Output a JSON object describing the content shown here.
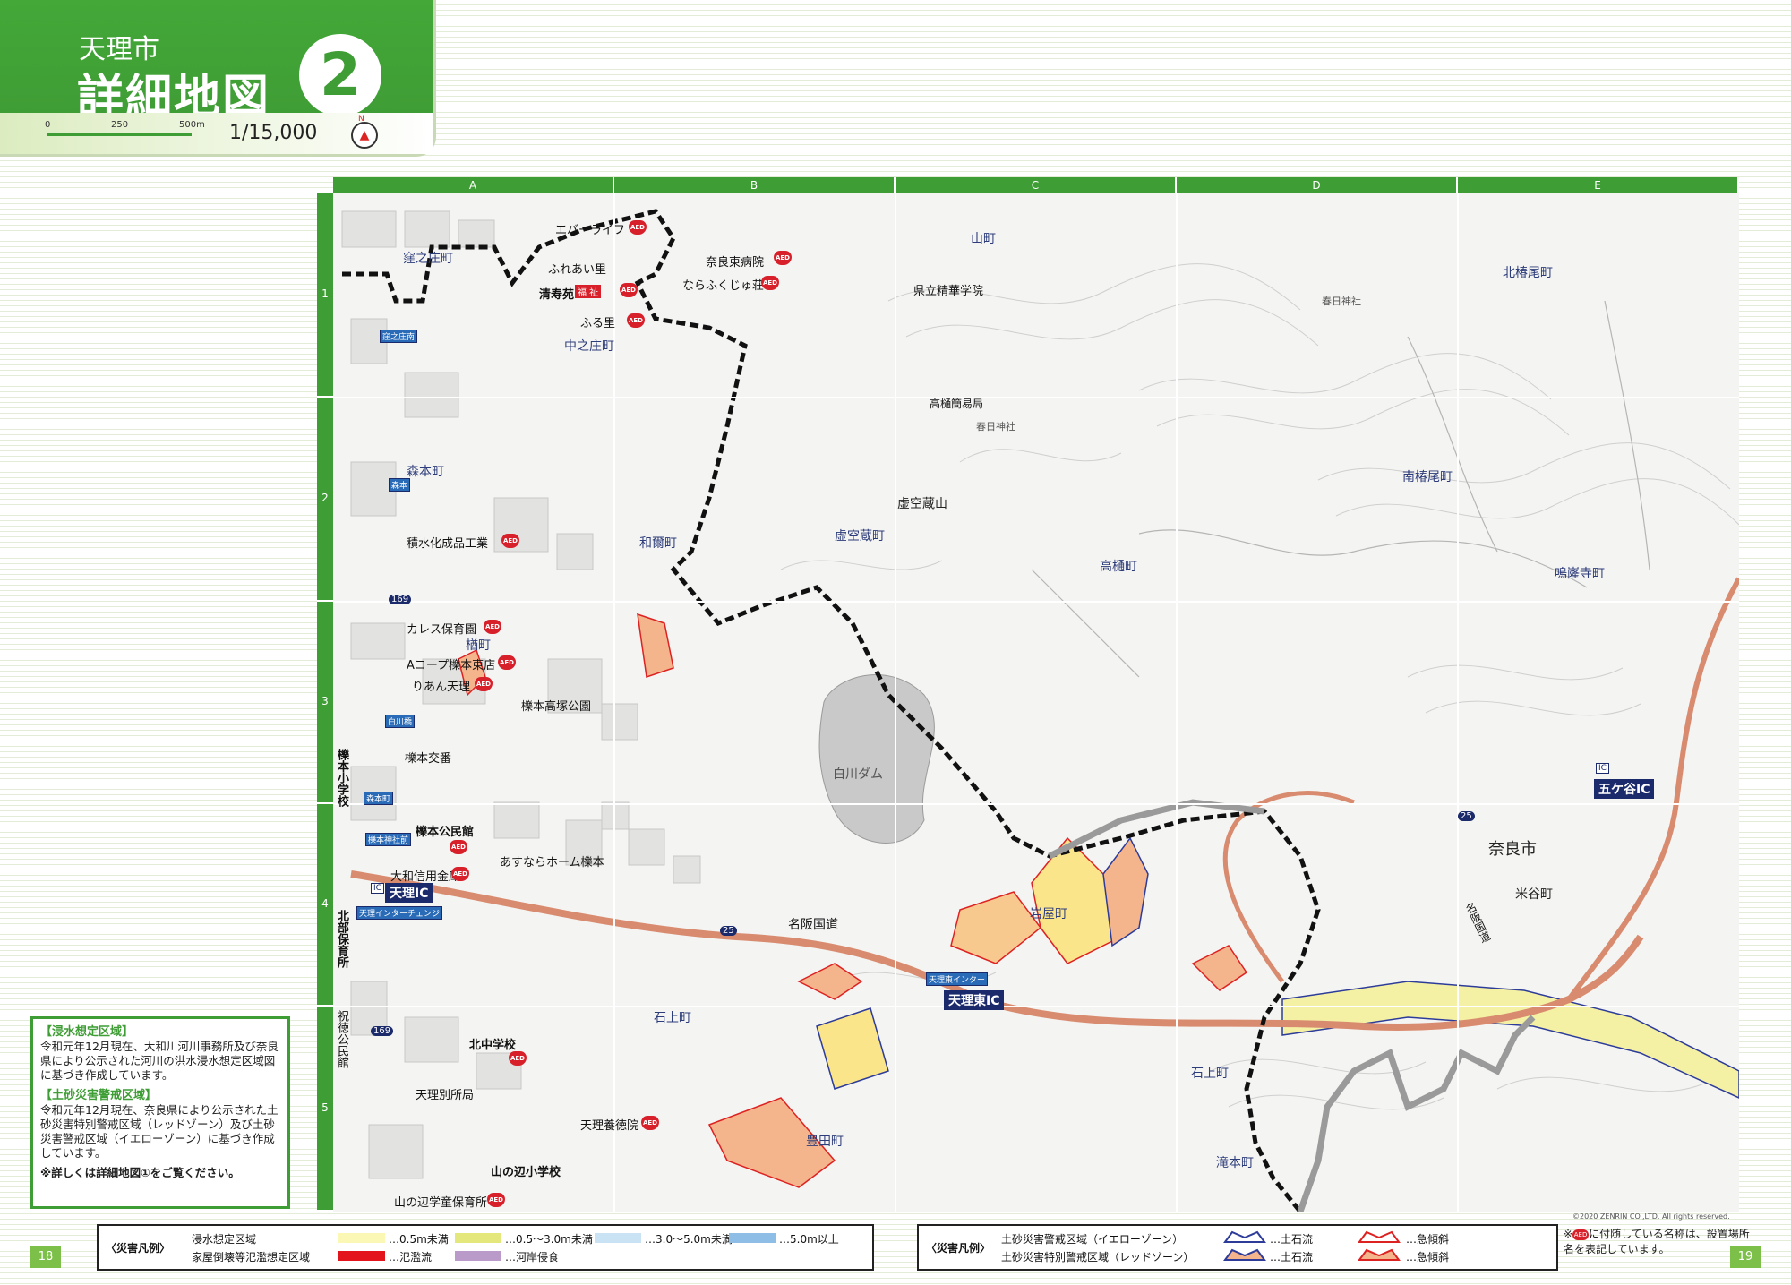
{
  "header": {
    "city": "天理市",
    "title": "詳細地図",
    "map_number": "2",
    "scale_ticks": [
      "0",
      "250",
      "500m"
    ],
    "scale_ratio": "1/15,000",
    "north": "N"
  },
  "grid": {
    "columns": [
      "A",
      "B",
      "C",
      "D",
      "E"
    ],
    "rows": [
      "1",
      "2",
      "3",
      "4",
      "5"
    ]
  },
  "map": {
    "area_labels": {
      "kuboshocho": "窪之庄町",
      "nakanoshocho": "中之庄町",
      "yamacho": "山町",
      "kitatsubaocho": "北椿尾町",
      "moricho": "森本町",
      "wanicho": "和爾町",
      "kokuzocho": "虚空蔵町",
      "takahicho": "高樋町",
      "minamitsubaocho": "南椿尾町",
      "ryuzanjicho": "鳴嶐寺町",
      "naracity": "奈良市",
      "yonetanicho": "米谷町",
      "iwayacho": "岩屋町",
      "isonokamicho": "石上町",
      "isonokamicho2": "石上町",
      "takimotocho": "滝本町",
      "toyodacho": "豊田町",
      "shirakawa_dam": "白川ダム",
      "kokuzozan": "虚空蔵山",
      "nashima": "楢町",
      "kasuga": "春日神社",
      "kasuga2": "春日神社"
    },
    "facilities": {
      "ever_life": "エバーライフ",
      "fureai": "ふれあい里",
      "nara_east_hosp": "奈良東病院",
      "narafukujusou": "ならふくじゅ荘",
      "seijuen": "清寿苑",
      "fukushi": "福 祉",
      "furusato": "ふる里",
      "prefectural": "県立精華学院",
      "takahi_post": "高樋簡易局",
      "kakou": "積水化成品工業",
      "karesu": "カレス保育園",
      "acoop": "Aコープ櫟本東店",
      "rian": "りあん天理",
      "park": "櫟本高塚公園",
      "koban": "櫟本交番",
      "elem": "櫟本小学校",
      "kominkan": "櫟本公民館",
      "asunara": "あすならホーム櫟本",
      "daiwa": "大和信用金庫",
      "hokubu_hoiku": "北部保育所",
      "kita_jhs": "北中学校",
      "bessho": "天理別所局",
      "yoseikan": "天理養徳院",
      "yamanobe_elem": "山の辺小学校",
      "yamanobe_hoiku": "山の辺学童保育所",
      "shukutoku": "祝徳公民館"
    },
    "roads": {
      "meihan": "名阪国道",
      "route25": "25",
      "route25b": "25",
      "route169": "169",
      "route169b": "169",
      "meihan_vertical": "名阪国道"
    },
    "interchanges": {
      "tenri_ic": "天理IC",
      "tenri_east_ic": "天理東IC",
      "gokatani_ic": "五ケ谷IC",
      "tenri_inter": "天理インターチェンジ",
      "tenri_east_inter": "天理東インター",
      "ic_tag": "IC",
      "ic_tag2": "IC"
    },
    "bus_stops": {
      "kubo": "窪之庄南",
      "mori": "森本",
      "shirakawa": "白川橋",
      "moricho_bus": "森本町",
      "ichinomoto": "櫟本神社前"
    },
    "aed": "AED",
    "copyright": "©2020 ZENRIN CO.,LTD. All rights reserved."
  },
  "info": {
    "flood_title": "【浸水想定区域】",
    "flood_text": "令和元年12月現在、大和川河川事務所及び奈良県により公示された河川の洪水浸水想定区域図に基づき作成しています。",
    "sediment_title": "【土砂災害警戒区域】",
    "sediment_text": "令和元年12月現在、奈良県により公示された土砂災害特別警戒区域（レッドゾーン）及び土砂災害警戒区域（イエローゾーン）に基づき作成しています。",
    "see_more": "※詳しくは詳細地図①をご覧ください。"
  },
  "legend_left": {
    "title": "〈災害凡例〉",
    "flood_area": "浸水想定区域",
    "collapse_area": "家屋倒壊等氾濫想定区域",
    "items": [
      {
        "label": "…0.5m未満",
        "color": "#fbf7b5"
      },
      {
        "label": "…0.5～3.0m未満",
        "color": "#e4e87c"
      },
      {
        "label": "…3.0～5.0m未満",
        "color": "#c9e2f4"
      },
      {
        "label": "…5.0m以上",
        "color": "#8ebde6"
      },
      {
        "label": "…氾濫流",
        "color": "#e3141b"
      },
      {
        "label": "…河岸侵食",
        "color": "#b99ac9"
      }
    ]
  },
  "legend_right": {
    "title": "〈災害凡例〉",
    "yellow_zone": "土砂災害警戒区域（イエローゾーン）",
    "red_zone": "土砂災害特別警戒区域（レッドゾーン）",
    "debris": "…土石流",
    "debris2": "…土石流",
    "slope": "…急傾斜",
    "slope2": "…急傾斜"
  },
  "note": {
    "text_pre": "※",
    "text_post": "に付随している名称は、設置場所名を表記しています。",
    "aed": "AED"
  },
  "pages": {
    "left": "18",
    "right": "19"
  },
  "colors": {
    "brand_green": "#3f9d35",
    "expressway": "#d98b6f",
    "aed_red": "#d8202a",
    "ic_navy": "#1b2a6b",
    "boundary": "#111111"
  }
}
